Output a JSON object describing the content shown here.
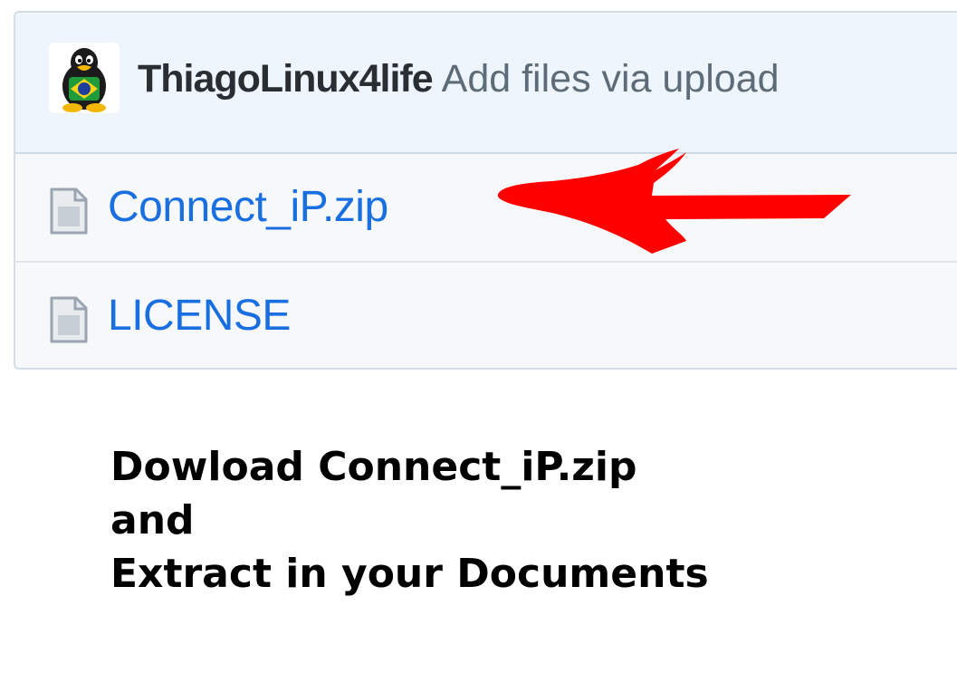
{
  "commit": {
    "author": "ThiagoLinux4life",
    "message": "Add files via upload",
    "avatar_icon": "tux-penguin-brazil-flag-icon"
  },
  "files": [
    {
      "name": "Connect_iP.zip",
      "icon": "file-icon"
    },
    {
      "name": "LICENSE",
      "icon": "file-icon"
    }
  ],
  "annotation": {
    "arrow_color": "#ff0000",
    "points_to": "Connect_iP.zip"
  },
  "instructions": {
    "line1": "Dowload Connect_iP.zip",
    "line2": "and",
    "line3": "Extract in your Documents"
  },
  "colors": {
    "link": "#1a6fe0",
    "commit_bar": "#eef5fc",
    "row_bg": "#f6f8fa",
    "border": "#d4dce6"
  }
}
